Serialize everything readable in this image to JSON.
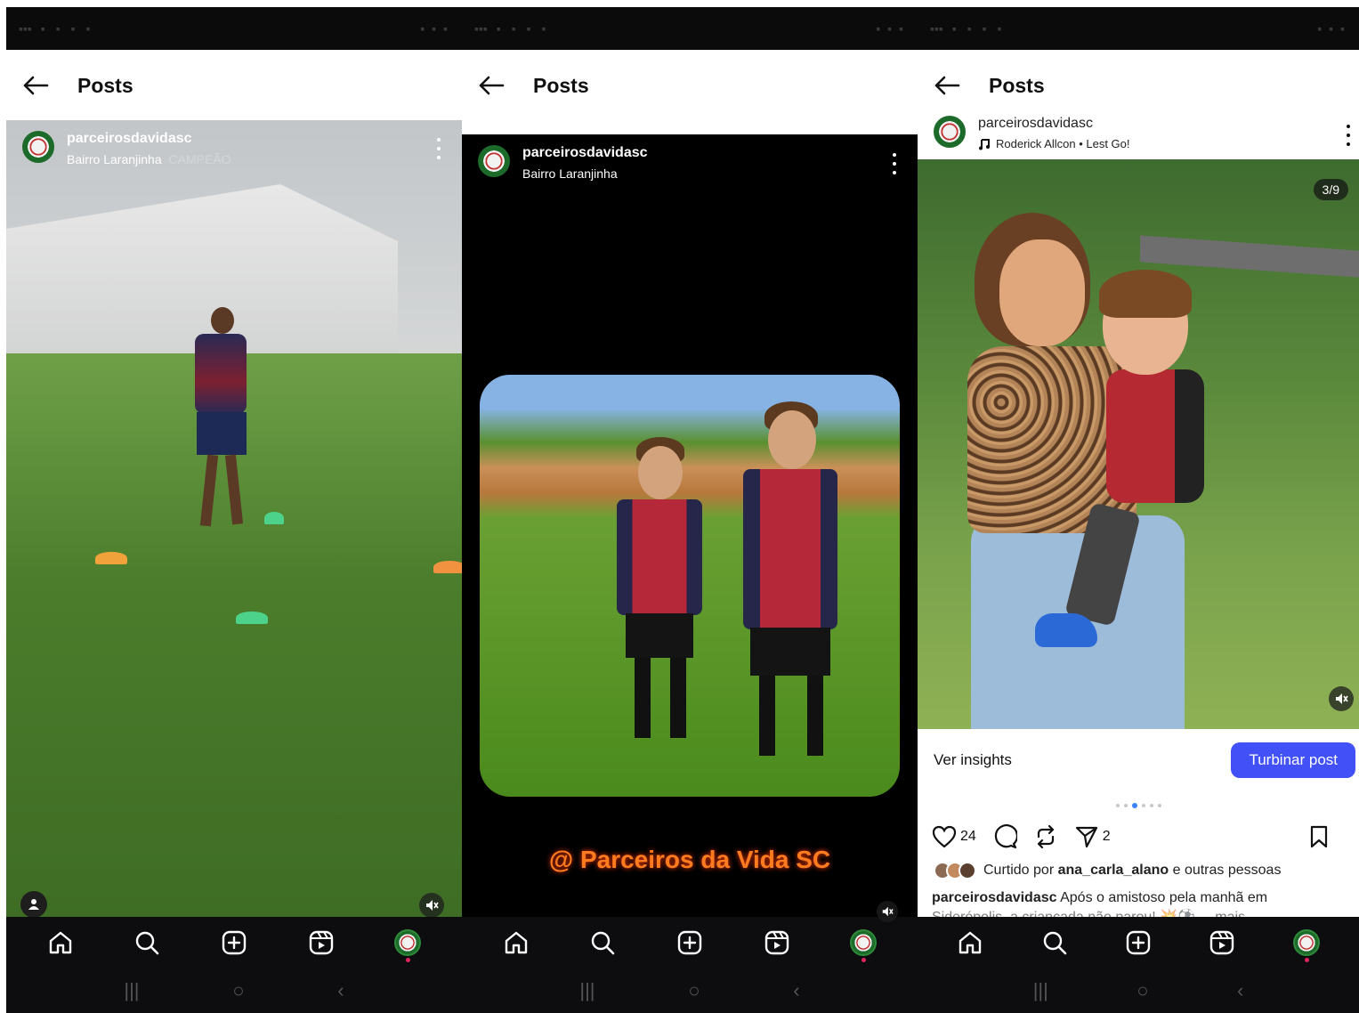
{
  "header": {
    "title": "Posts"
  },
  "post1": {
    "username": "parceirosdavidasc",
    "location": "Bairro Laranjinha",
    "overlay_text": "CAMPEÃO"
  },
  "post2": {
    "username": "parceirosdavidasc",
    "location": "Bairro Laranjinha",
    "caption_overlay": "@ Parceiros da Vida SC"
  },
  "post3": {
    "username": "parceirosdavidasc",
    "audio": "Roderick Allcon • Lest Go!",
    "counter": "3/9",
    "insights_label": "Ver insights",
    "boost_label": "Turbinar post",
    "likes_count": "24",
    "shares_count": "2",
    "liked_by_prefix": "Curtido por",
    "liked_by_user": "ana_carla_alano",
    "liked_by_suffix": "e outras pessoas",
    "caption_user": "parceirosdavidasc",
    "caption_text": "Após o amistoso pela manhã em",
    "caption_more": "Siderópolis, a criançada não parou! 💥⚽ ... mais"
  },
  "icons": [
    "back-arrow-icon",
    "more-vertical-icon",
    "mute-icon",
    "home-icon",
    "search-icon",
    "create-icon",
    "reels-icon",
    "profile-avatar",
    "heart-icon",
    "comment-icon",
    "repost-icon",
    "share-icon",
    "bookmark-icon",
    "music-note-icon"
  ],
  "colors": {
    "accent": "#4150f7",
    "statusbar": "#0b0b0c",
    "navbar": "#0d0d0f",
    "overlay_text": "#ff7b1f"
  }
}
